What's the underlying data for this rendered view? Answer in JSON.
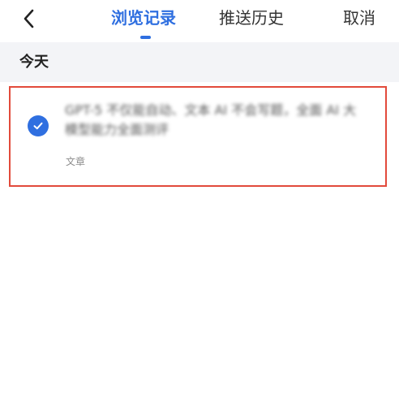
{
  "header": {
    "back_icon": "chevron-left-icon",
    "tabs": [
      {
        "label": "浏览记录",
        "active": true
      },
      {
        "label": "推送历史",
        "active": false
      }
    ],
    "cancel_label": "取消"
  },
  "section": {
    "title": "今天"
  },
  "items": [
    {
      "selected": true,
      "title": "GPT-5 不仅能自动、文本 AI 不会写题，全面 AI 大模型能力全面测评",
      "type": "文章"
    }
  ],
  "colors": {
    "accent": "#2f6fe0",
    "highlight_border": "#e24a3b",
    "section_bg": "#f3f4f7"
  }
}
